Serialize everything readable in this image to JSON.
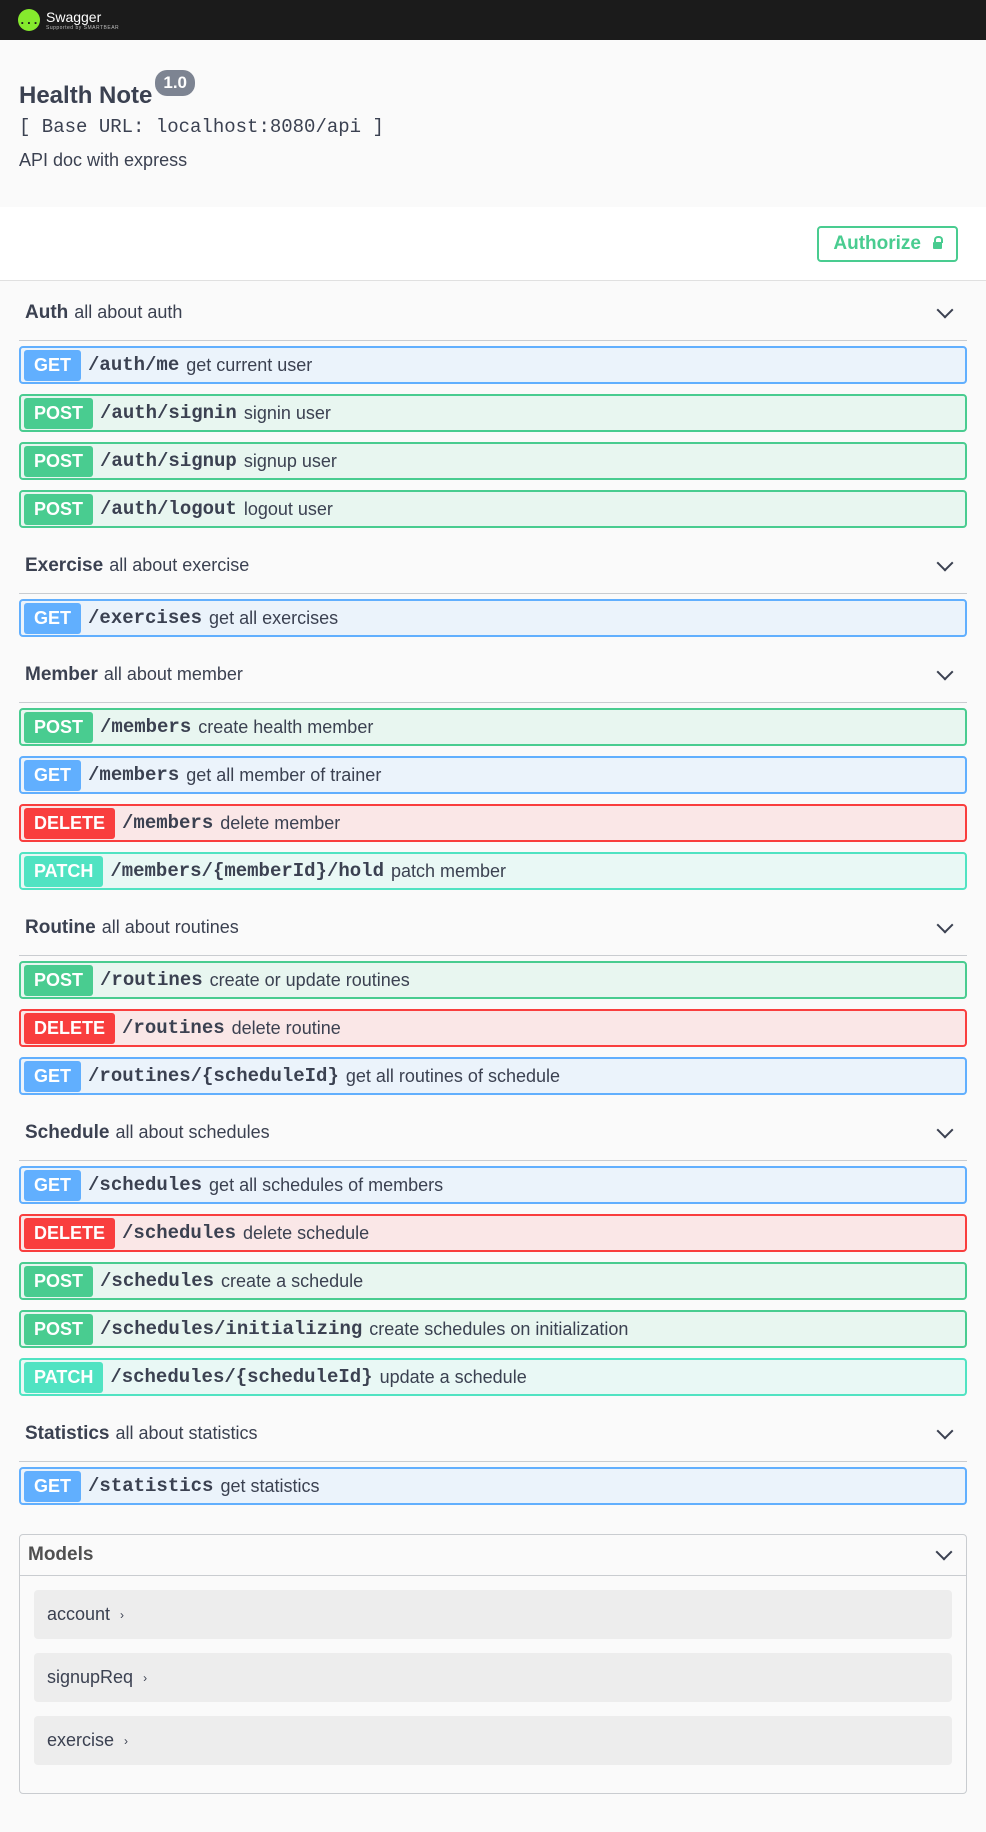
{
  "topbar": {
    "logo_title": "Swagger",
    "logo_sub": "Supported by SMARTBEAR",
    "logo_icon": "{...}"
  },
  "info": {
    "title": "Health Note",
    "version": "1.0",
    "base_url": "[ Base URL: localhost:8080/api ]",
    "description": "API doc with express"
  },
  "authorize": {
    "label": "Authorize"
  },
  "tags": [
    {
      "name": "Auth",
      "description": "all about auth",
      "ops": [
        {
          "method": "GET",
          "path": "/auth/me",
          "summary": "get current user"
        },
        {
          "method": "POST",
          "path": "/auth/signin",
          "summary": "signin user"
        },
        {
          "method": "POST",
          "path": "/auth/signup",
          "summary": "signup user"
        },
        {
          "method": "POST",
          "path": "/auth/logout",
          "summary": "logout user"
        }
      ]
    },
    {
      "name": "Exercise",
      "description": "all about exercise",
      "ops": [
        {
          "method": "GET",
          "path": "/exercises",
          "summary": "get all exercises"
        }
      ]
    },
    {
      "name": "Member",
      "description": "all about member",
      "ops": [
        {
          "method": "POST",
          "path": "/members",
          "summary": "create health member"
        },
        {
          "method": "GET",
          "path": "/members",
          "summary": "get all member of trainer"
        },
        {
          "method": "DELETE",
          "path": "/members",
          "summary": "delete member"
        },
        {
          "method": "PATCH",
          "path": "/members/{memberId}/hold",
          "summary": "patch member"
        }
      ]
    },
    {
      "name": "Routine",
      "description": "all about routines",
      "ops": [
        {
          "method": "POST",
          "path": "/routines",
          "summary": "create or update routines"
        },
        {
          "method": "DELETE",
          "path": "/routines",
          "summary": "delete routine"
        },
        {
          "method": "GET",
          "path": "/routines/{scheduleId}",
          "summary": "get all routines of schedule"
        }
      ]
    },
    {
      "name": "Schedule",
      "description": "all about schedules",
      "ops": [
        {
          "method": "GET",
          "path": "/schedules",
          "summary": "get all schedules of members"
        },
        {
          "method": "DELETE",
          "path": "/schedules",
          "summary": "delete schedule"
        },
        {
          "method": "POST",
          "path": "/schedules",
          "summary": "create a schedule"
        },
        {
          "method": "POST",
          "path": "/schedules/initializing",
          "summary": "create schedules on initialization"
        },
        {
          "method": "PATCH",
          "path": "/schedules/{scheduleId}",
          "summary": "update a schedule"
        }
      ]
    },
    {
      "name": "Statistics",
      "description": "all about statistics",
      "ops": [
        {
          "method": "GET",
          "path": "/statistics",
          "summary": "get statistics"
        }
      ]
    }
  ],
  "models": {
    "title": "Models",
    "items": [
      "account",
      "signupReq",
      "exercise"
    ]
  },
  "colors": {
    "get": "#61affe",
    "post": "#49cc90",
    "delete": "#f93e3e",
    "patch": "#50e3c2"
  }
}
